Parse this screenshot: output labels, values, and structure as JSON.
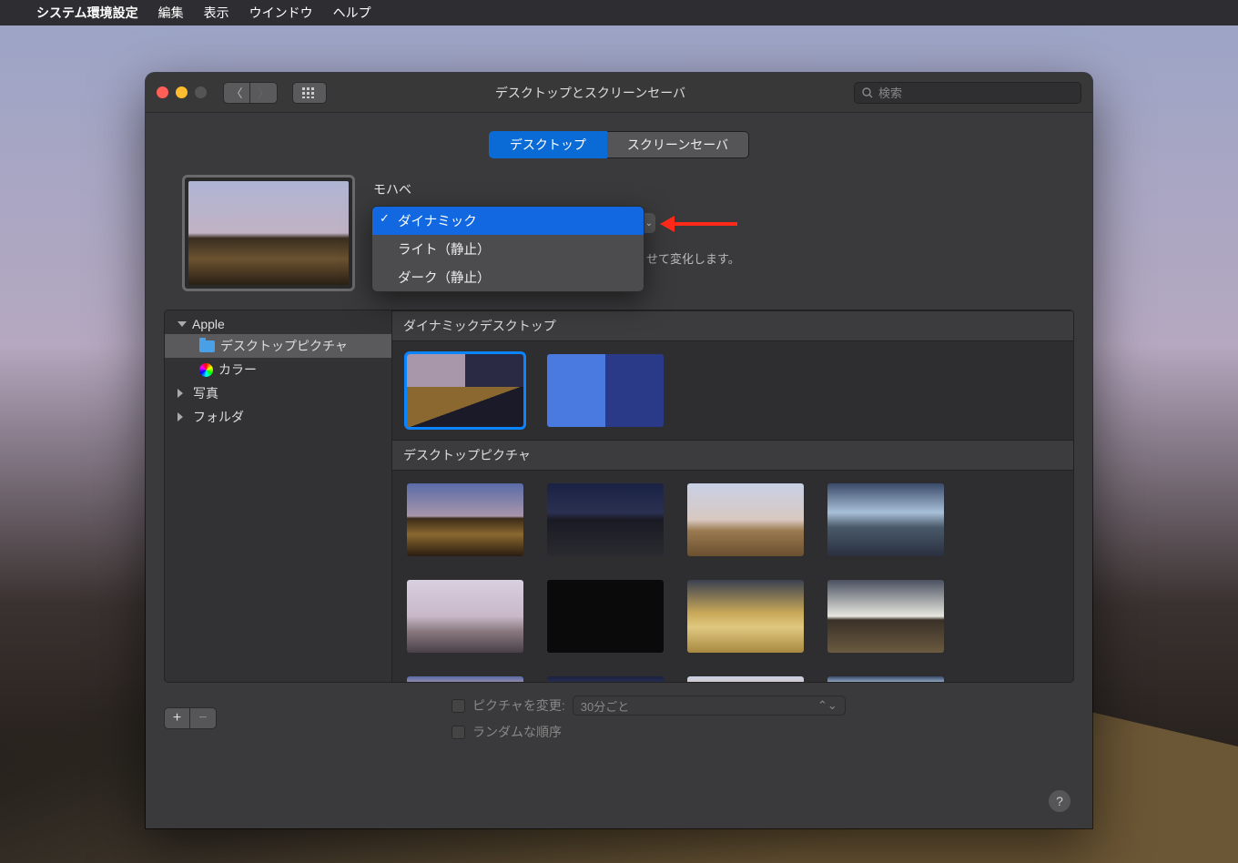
{
  "menubar": {
    "app": "システム環境設定",
    "items": [
      "編集",
      "表示",
      "ウインドウ",
      "ヘルプ"
    ]
  },
  "window": {
    "title": "デスクトップとスクリーンセーバ",
    "search_placeholder": "検索"
  },
  "tabs": {
    "desktop": "デスクトップ",
    "screensaver": "スクリーンセーバ"
  },
  "preview": {
    "name": "モハベ",
    "desc_tail": "せて変化します。"
  },
  "dropdown": {
    "items": [
      "ダイナミック",
      "ライト（静止）",
      "ダーク（静止）"
    ],
    "selected": 0
  },
  "sidebar": {
    "apple": "Apple",
    "desktop_pictures": "デスクトップピクチャ",
    "colors": "カラー",
    "photos": "写真",
    "folders": "フォルダ"
  },
  "sections": {
    "dynamic": "ダイナミックデスクトップ",
    "pictures": "デスクトップピクチャ"
  },
  "bottom": {
    "change_picture": "ピクチャを変更:",
    "interval": "30分ごと",
    "random": "ランダムな順序"
  }
}
